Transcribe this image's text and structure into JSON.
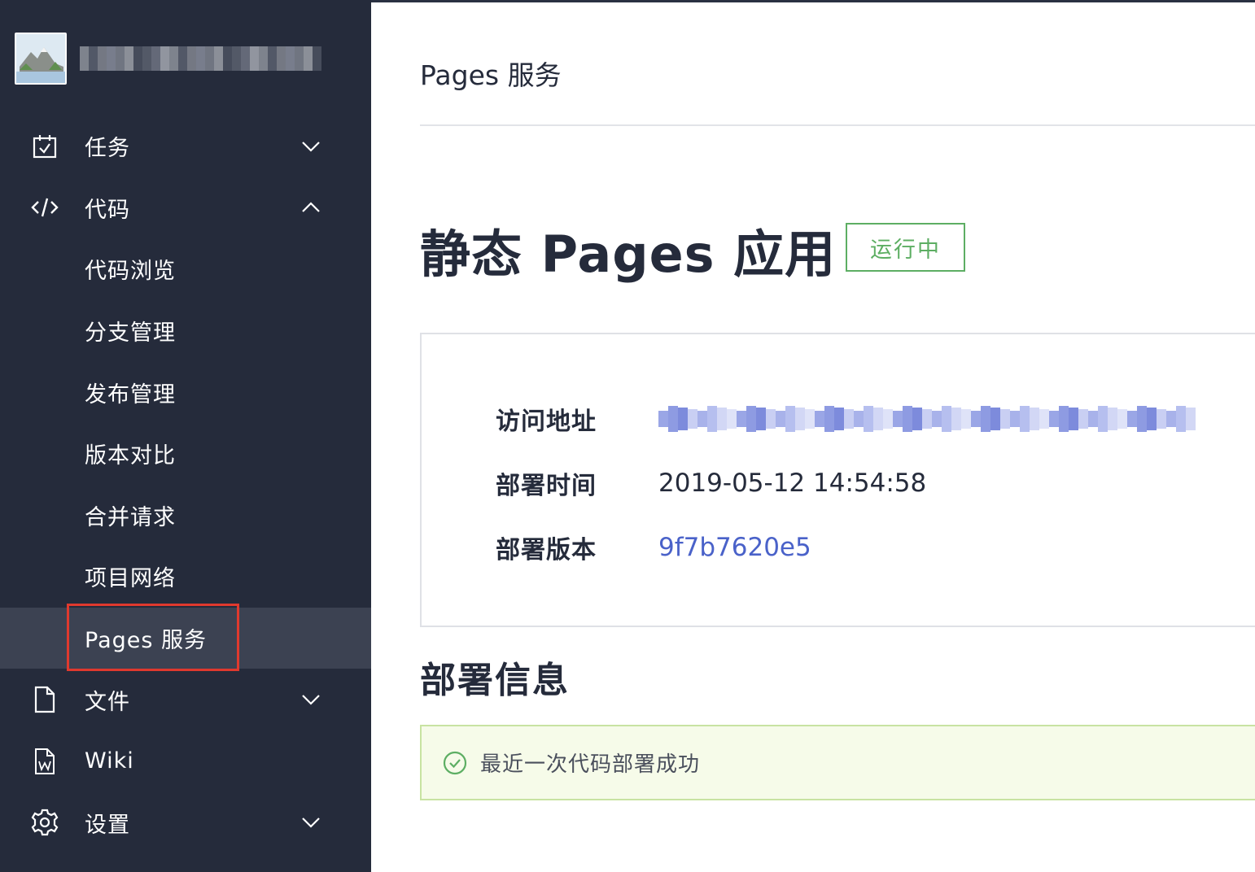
{
  "project": {
    "avatar_icon": "mountain-landscape-avatar",
    "name_obscured": true
  },
  "sidebar": {
    "items": [
      {
        "label": "任务",
        "icon": "calendar-check-icon",
        "chevron": "down"
      },
      {
        "label": "代码",
        "icon": "code-icon",
        "chevron": "up"
      },
      {
        "label": "代码浏览"
      },
      {
        "label": "分支管理"
      },
      {
        "label": "发布管理"
      },
      {
        "label": "版本对比"
      },
      {
        "label": "合并请求"
      },
      {
        "label": "项目网络"
      },
      {
        "label": "Pages 服务",
        "active": true
      },
      {
        "label": "文件",
        "icon": "file-icon",
        "chevron": "down"
      },
      {
        "label": "Wiki",
        "icon": "wiki-doc-icon"
      },
      {
        "label": "设置",
        "icon": "gear-icon",
        "chevron": "down"
      }
    ]
  },
  "header": {
    "title": "Pages 服务"
  },
  "app": {
    "title": "静态 Pages 应用",
    "status": "运行中"
  },
  "info": {
    "rows": [
      {
        "key": "访问地址",
        "value_obscured": true
      },
      {
        "key": "部署时间",
        "value": "2019-05-12 14:54:58"
      },
      {
        "key": "部署版本",
        "value": "9f7b7620e5"
      }
    ]
  },
  "deploy": {
    "section_title": "部署信息",
    "message": "最近一次代码部署成功",
    "message_icon": "check-circle-icon"
  },
  "colors": {
    "sidebar_bg": "#252b3b",
    "sidebar_active": "#3c4252",
    "highlight": "#e0392e",
    "status_green": "#5dae63",
    "link_blue": "#4a62c9",
    "success_bg": "#f6fbe9"
  }
}
